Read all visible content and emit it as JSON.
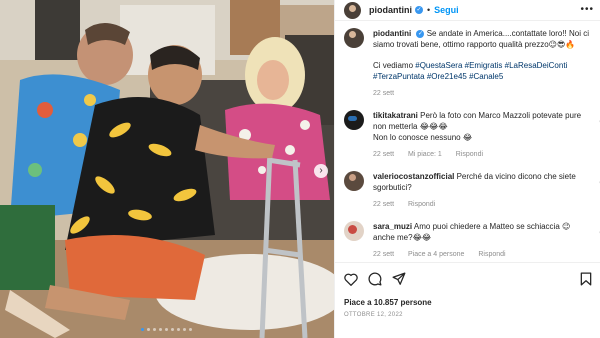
{
  "post": {
    "username": "piodantini",
    "separator": "•",
    "follow_label": "Segui",
    "more_icon": "more-horizontal-icon",
    "likes": "Piace a 10.857 persone",
    "date": "OTTOBRE 12, 2022",
    "carousel": {
      "slide_count": 9,
      "active_index": 0
    }
  },
  "caption": {
    "username": "piodantini",
    "text": "Se andate in America....contattate loro!! Noi ci siamo trovati bene, ottimo rapporto qualità prezzo😉😎🔥",
    "text2": "Ci vediamo",
    "hashtags": "#QuestaSera #Emigratis #LaResaDeiConti #TerzaPuntata #Ore21e45 #Canale5",
    "time": "22 sett"
  },
  "comments": [
    {
      "username": "tikitakatrani",
      "text": "Però la foto con Marco Mazzoli potevate pure non metterla 😂😂😂",
      "text2": "Non lo conosce nessuno 😂",
      "time": "22 sett",
      "likes": "Mi piace: 1",
      "reply": "Rispondi"
    },
    {
      "username": "valeriocostanzofficial",
      "text": "Perché da vicino dicono che siete sgorbutici?",
      "time": "22 sett",
      "reply": "Rispondi"
    },
    {
      "username": "sara_muzi",
      "text": "Amo puoi chiedere a Matteo se schiaccia 😉 anche me?😂😂",
      "time": "22 sett",
      "likes": "Piace a 4 persone",
      "reply": "Rispondi"
    }
  ],
  "colors": {
    "link": "#0095f6",
    "hashtag": "#00376b",
    "muted": "#8e8e8e",
    "verified": "#3897f0"
  }
}
